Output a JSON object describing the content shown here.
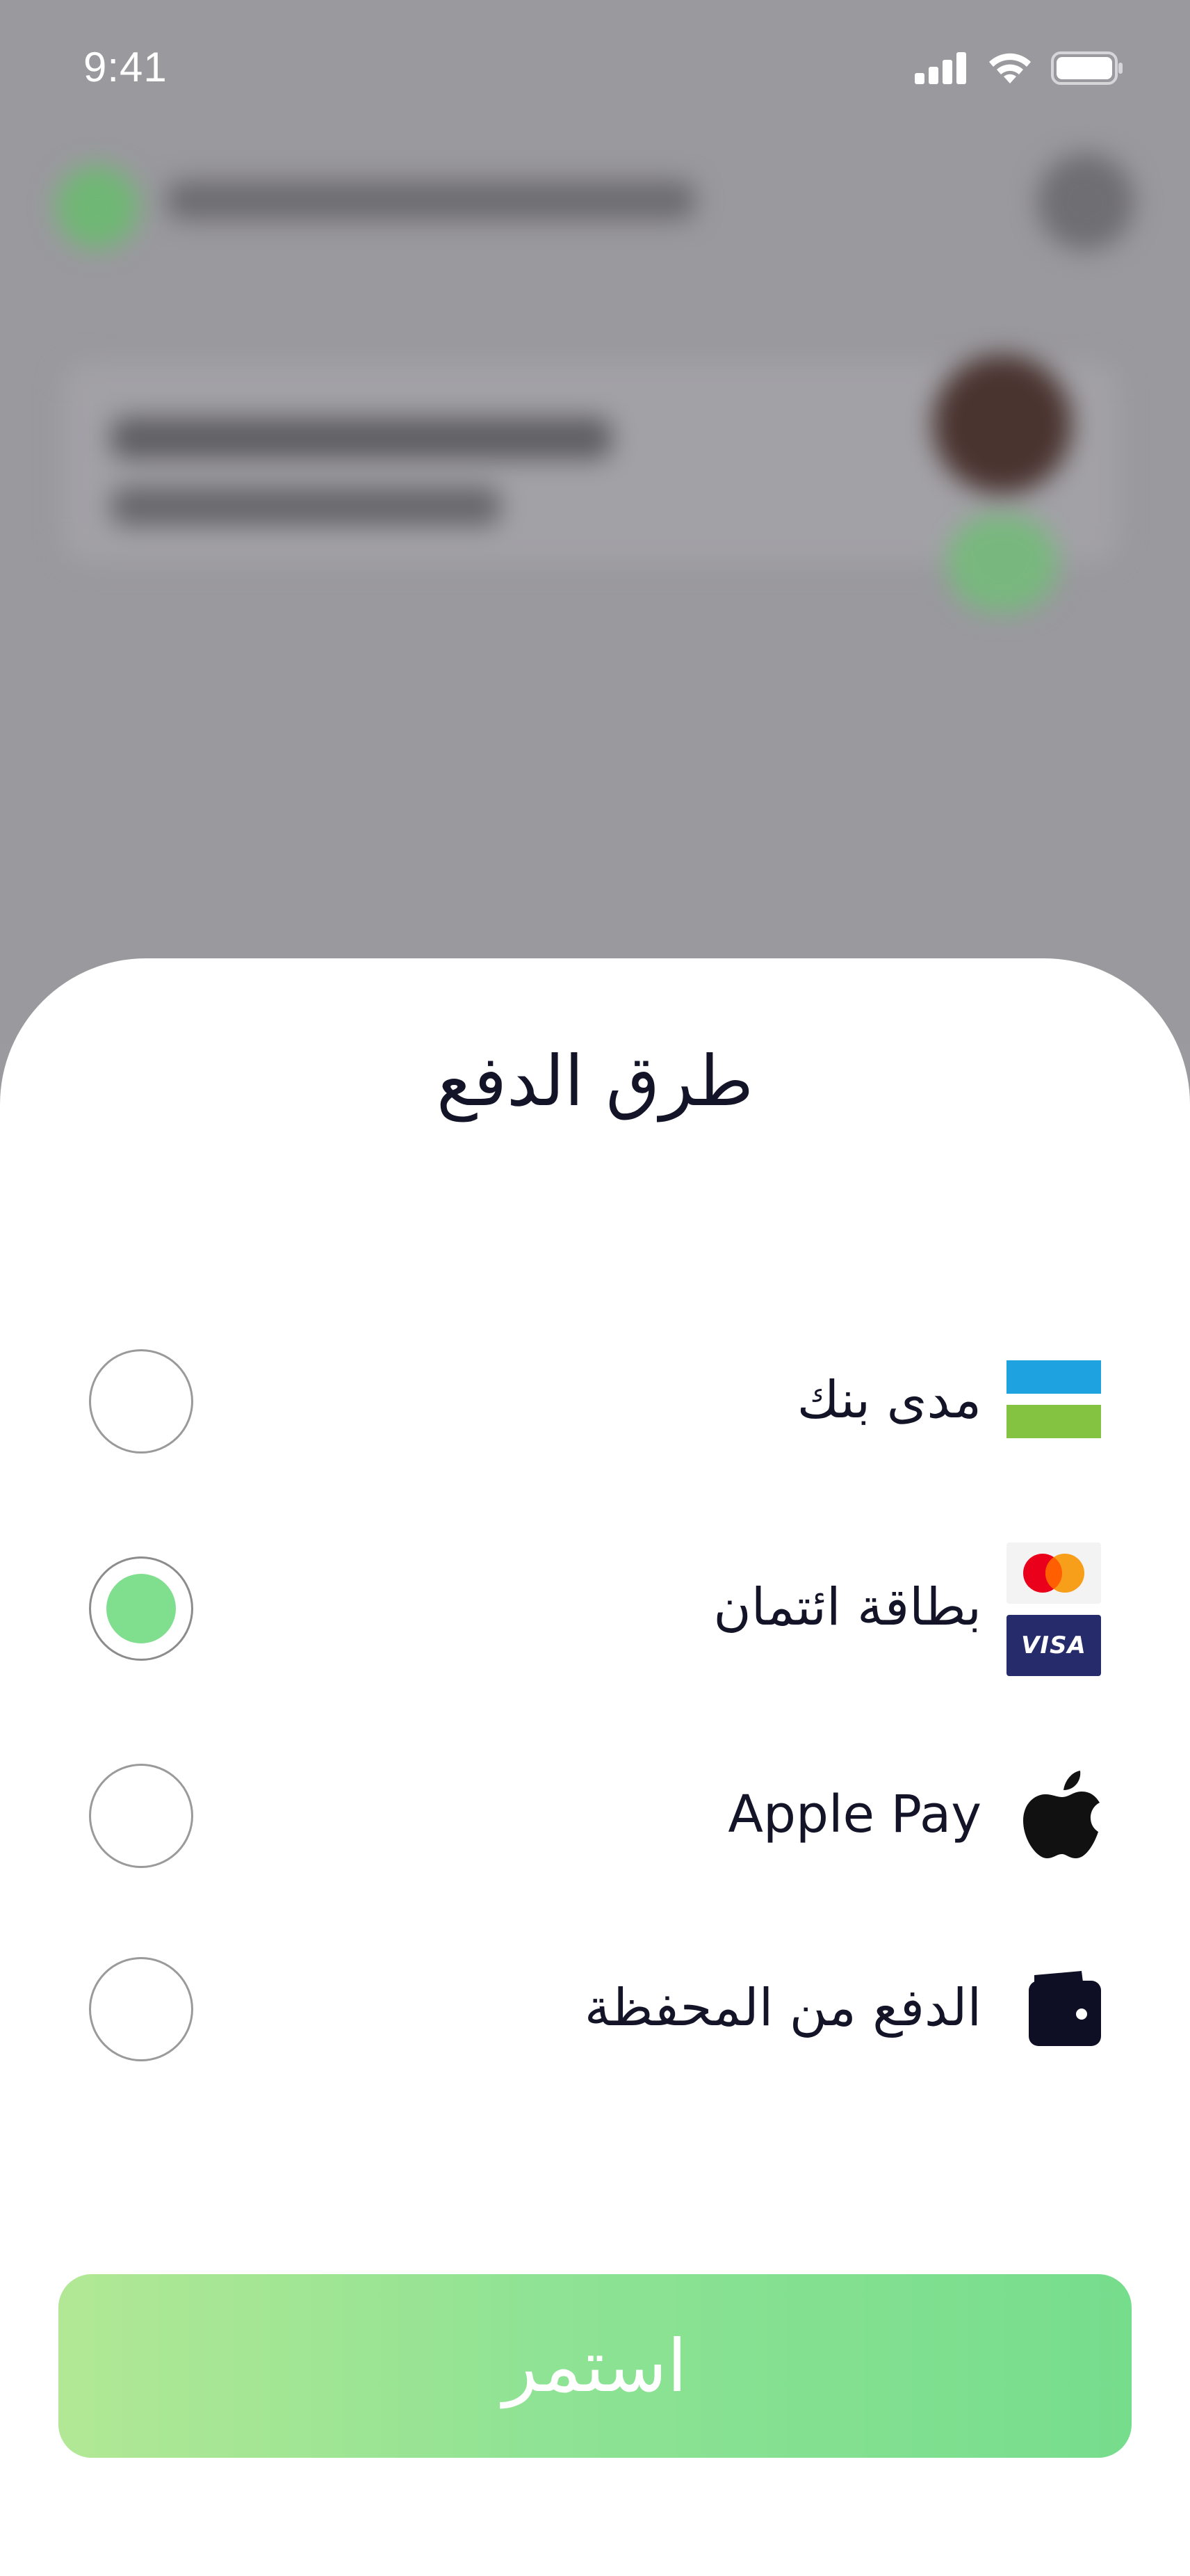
{
  "status_bar": {
    "time": "9:41"
  },
  "sheet": {
    "title": "طرق الدفع",
    "options": [
      {
        "label": "مدى بنك",
        "icon": "mada-icon",
        "selected": false
      },
      {
        "label": "بطاقة ائتمان",
        "icon": "mastercard-visa-icon",
        "selected": true
      },
      {
        "label": "Apple Pay",
        "icon": "apple-icon",
        "selected": false
      },
      {
        "label": "الدفع من المحفظة",
        "icon": "wallet-icon",
        "selected": false
      }
    ],
    "continue_label": "استمر",
    "visa_text": "VISA"
  },
  "colors": {
    "accent_green": "#80df8e",
    "button_gradient_start": "#b2e895",
    "button_gradient_end": "#76dd8d",
    "text_dark": "#141428",
    "overlay_gray": "#9a999e"
  }
}
